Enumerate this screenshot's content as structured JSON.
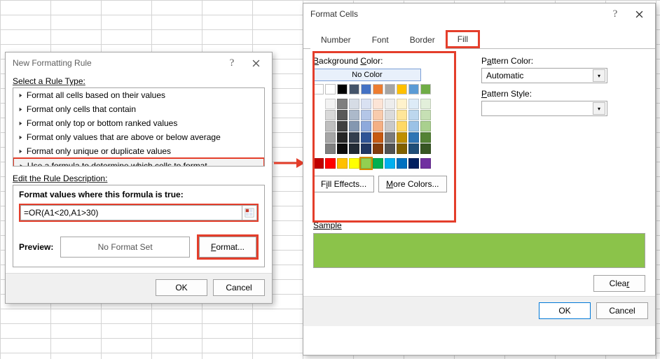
{
  "nfr": {
    "title": "New Formatting Rule",
    "selectRuleType": "Select a Rule Type:",
    "rules": [
      "Format all cells based on their values",
      "Format only cells that contain",
      "Format only top or bottom ranked values",
      "Format only values that are above or below average",
      "Format only unique or duplicate values",
      "Use a formula to determine which cells to format"
    ],
    "editDesc": "Edit the Rule Description:",
    "formulaLabel": "Format values where this formula is true:",
    "formula": "=OR(A1<20,A1>30)",
    "previewLabel": "Preview:",
    "noFormat": "No Format Set",
    "formatBtn": "Format...",
    "ok": "OK",
    "cancel": "Cancel"
  },
  "fc": {
    "title": "Format Cells",
    "tabs": {
      "number": "Number",
      "font": "Font",
      "border": "Border",
      "fill": "Fill"
    },
    "bgColor": "Background Color:",
    "noColor": "No Color",
    "fillEffects": "Fill Effects...",
    "moreColors": "More Colors...",
    "patternColor": "Pattern Color:",
    "patternColorValue": "Automatic",
    "patternStyle": "Pattern Style:",
    "sample": "Sample",
    "clear": "Clear",
    "ok": "OK",
    "cancel": "Cancel",
    "sampleColor": "#8bc34a",
    "theme_row1": [
      "#ffffff",
      "#000000",
      "#44546a",
      "#4472c4",
      "#ed7d31",
      "#a5a5a5",
      "#ffc000",
      "#5b9bd5",
      "#70ad47"
    ],
    "theme_grid": [
      [
        "#f2f2f2",
        "#7f7f7f",
        "#d6dce5",
        "#d9e1f2",
        "#fce4d6",
        "#ededed",
        "#fff2cc",
        "#ddebf7",
        "#e2efda"
      ],
      [
        "#d9d9d9",
        "#595959",
        "#acb9ca",
        "#b4c6e7",
        "#f8cbad",
        "#dbdbdb",
        "#ffe699",
        "#bdd7ee",
        "#c6e0b4"
      ],
      [
        "#bfbfbf",
        "#404040",
        "#8497b0",
        "#8ea9db",
        "#f4b084",
        "#c9c9c9",
        "#ffd966",
        "#9bc2e6",
        "#a9d08e"
      ],
      [
        "#a6a6a6",
        "#262626",
        "#333f4f",
        "#305496",
        "#c65911",
        "#7b7b7b",
        "#bf8f00",
        "#2f75b5",
        "#548235"
      ],
      [
        "#808080",
        "#0d0d0d",
        "#222b35",
        "#203764",
        "#833c0c",
        "#525252",
        "#806000",
        "#1f4e78",
        "#375623"
      ]
    ],
    "standard": [
      "#c00000",
      "#ff0000",
      "#ffc000",
      "#ffff00",
      "#92d050",
      "#00b050",
      "#00b0f0",
      "#0070c0",
      "#002060",
      "#7030a0"
    ]
  }
}
